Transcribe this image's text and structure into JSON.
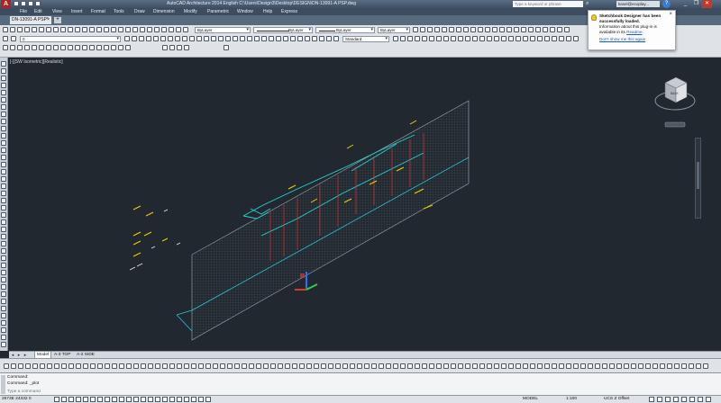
{
  "app": {
    "logo_letter": "A",
    "title_text": "AutoCAD Architecture 2014    English    C:\\Users\\Design3\\Desktop\\DESIGN\\DN-13091-A PSP.dwg",
    "search_placeholder": "Type a keyword or phrase",
    "signin_text": "kasel@ecoplay...",
    "window_controls": [
      "_",
      "❐",
      "✕"
    ]
  },
  "menu": [
    "File",
    "Edit",
    "View",
    "Insert",
    "Format",
    "Tools",
    "Draw",
    "Dimension",
    "Modify",
    "Parametric",
    "Window",
    "Help",
    "Express"
  ],
  "document": {
    "tab_label": "DN-13091-A PSP*",
    "close": "×",
    "add": "+"
  },
  "toolbar": {
    "layer_value": "0",
    "color_value": "ByLayer",
    "linetype_value": "ByLayer",
    "lineweight_value": "ByLayer",
    "color2_value": "ByLayer",
    "plotstyle_value": "Standard"
  },
  "notification": {
    "title": "Sketchbook Designer has been successfully loaded.",
    "body_pre": "Information about this plug-in is available in its ",
    "readme_link": "Readme",
    "body_post": ".",
    "dismiss": "Don't show me this again",
    "close": "×"
  },
  "viewport": {
    "label": "[-][SW Isometric][Realistic]",
    "viewcube_face": "BACK"
  },
  "layout_tabs": [
    "Model",
    "A-3 TOP",
    "A-2 SIDE"
  ],
  "command": {
    "history_1": "Command:",
    "history_2": "Command:  _plot",
    "placeholder": "Type a command"
  },
  "status": {
    "coords": "2673E 24332 0",
    "model": "MODEL",
    "scale": "1:100",
    "ucs": "UCS Z Offset"
  },
  "colors": {
    "background": "#212830",
    "wall_grid": "#4f5964",
    "cyan": "#27d3d3",
    "red": "#e0332f",
    "yellow": "#f0d000",
    "gizmo_blue": "#2a6fff"
  }
}
